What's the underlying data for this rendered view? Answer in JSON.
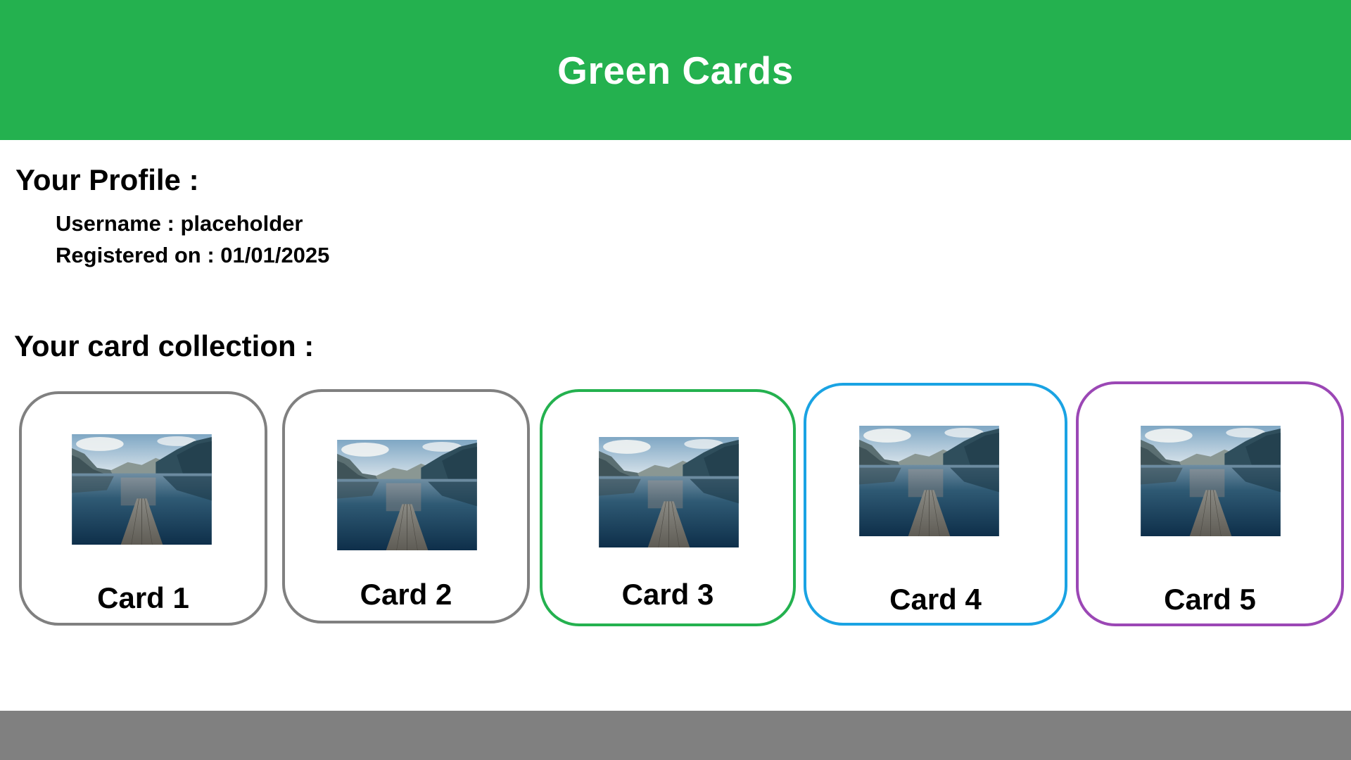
{
  "header": {
    "title": "Green Cards",
    "color": "#24b14f"
  },
  "profile": {
    "title": "Your Profile :",
    "username_line": "Username : placeholder",
    "registered_line": "Registered on : 01/01/2025"
  },
  "collection": {
    "title": "Your card collection :",
    "cards": [
      {
        "label": "Card 1",
        "border_color": "#808080",
        "image": "lake-dock-photo"
      },
      {
        "label": "Card 2",
        "border_color": "#808080",
        "image": "lake-dock-photo"
      },
      {
        "label": "Card 3",
        "border_color": "#24b14f",
        "image": "lake-dock-photo"
      },
      {
        "label": "Card 4",
        "border_color": "#1aa3e3",
        "image": "lake-dock-photo"
      },
      {
        "label": "Card 5",
        "border_color": "#9b47b5",
        "image": "lake-dock-photo"
      }
    ]
  },
  "footer": {
    "color": "#808080"
  }
}
